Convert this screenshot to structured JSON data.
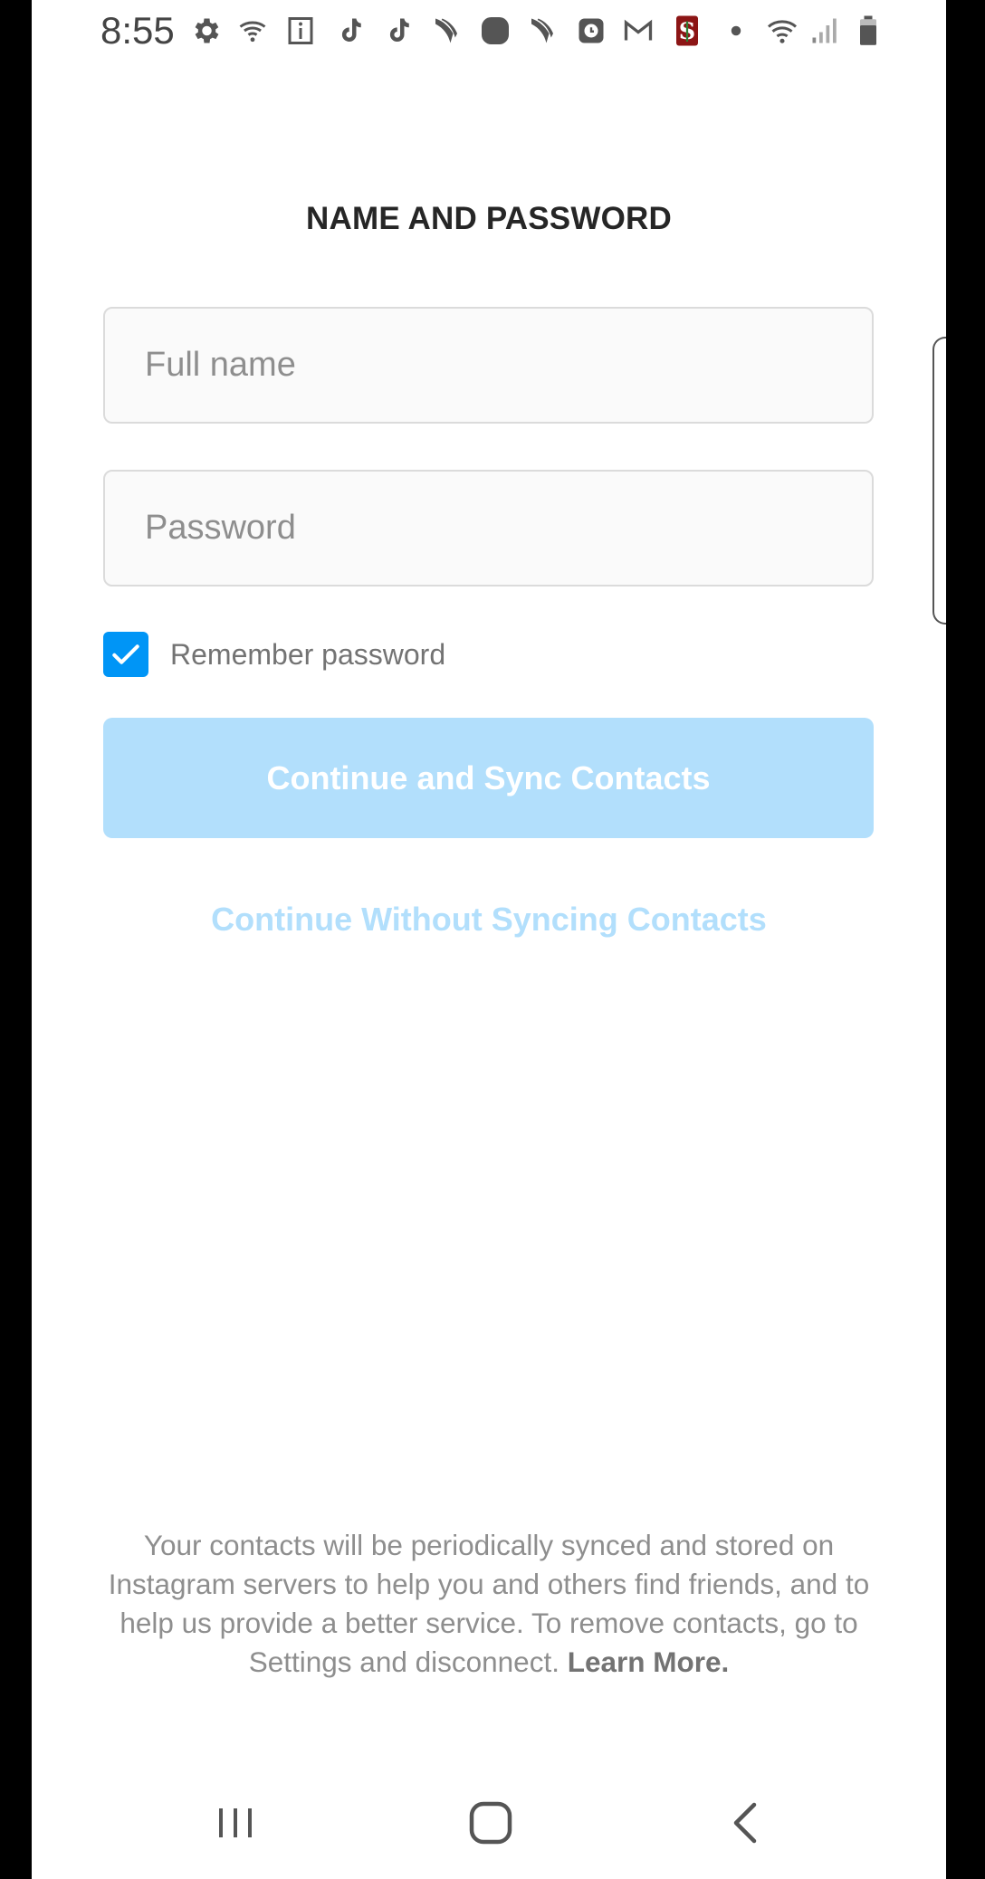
{
  "status_bar": {
    "time": "8:55",
    "icons": [
      "gear-icon",
      "wifi-calling-icon",
      "info-icon",
      "tiktok-icon",
      "tiktok-icon",
      "sprint-icon",
      "app-icon",
      "sprint-icon",
      "clock-app-icon",
      "gmail-icon",
      "stanford-icon",
      "dot-icon",
      "wifi-icon",
      "signal-icon",
      "battery-icon"
    ]
  },
  "page": {
    "title": "NAME AND PASSWORD"
  },
  "form": {
    "full_name_placeholder": "Full name",
    "full_name_value": "",
    "password_placeholder": "Password",
    "password_value": "",
    "remember_label": "Remember password",
    "remember_checked": true
  },
  "actions": {
    "primary_label": "Continue and Sync Contacts",
    "secondary_label": "Continue Without Syncing Contacts"
  },
  "footer": {
    "text": "Your contacts will be periodically synced and stored on Instagram servers to help you and others find friends, and to help us provide a better service. To remove contacts, go to Settings and disconnect.",
    "learn_more": "Learn More."
  },
  "colors": {
    "accent": "#0095f6",
    "button_disabled": "#b2dffc",
    "title": "#262626",
    "muted_text": "#8e8e8e"
  },
  "nav_bar": {
    "buttons": [
      "recents-icon",
      "home-icon",
      "back-icon"
    ]
  }
}
